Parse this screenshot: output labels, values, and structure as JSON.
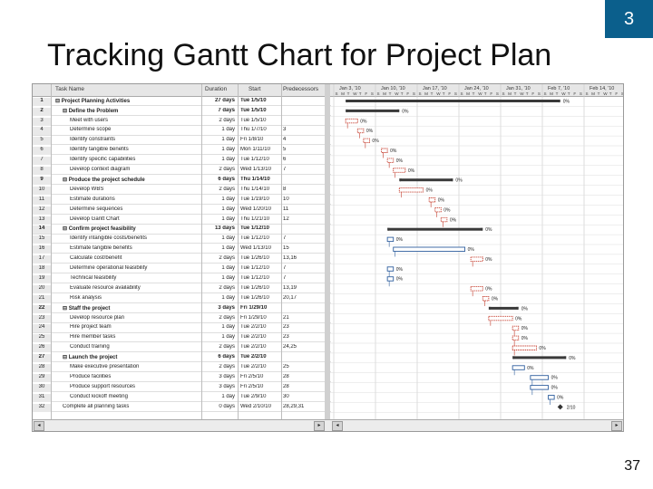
{
  "slide": {
    "title": "Tracking Gantt Chart for Project Plan",
    "section_number": "3",
    "page_number": "37"
  },
  "table": {
    "columns": [
      "Task Name",
      "Duration",
      "Start",
      "Predecessors"
    ],
    "rows": [
      {
        "id": "1",
        "name": "⊟ Project Planning Activities",
        "duration": "27 days",
        "start": "Tue 1/5/10",
        "pred": "",
        "summary": true,
        "indent": 0
      },
      {
        "id": "2",
        "name": "⊟ Define the Problem",
        "duration": "7 days",
        "start": "Tue 1/5/10",
        "pred": "",
        "summary": true,
        "indent": 1
      },
      {
        "id": "3",
        "name": "Meet with users",
        "duration": "2 days",
        "start": "Tue 1/5/10",
        "pred": "",
        "summary": false,
        "indent": 2
      },
      {
        "id": "4",
        "name": "Determine scope",
        "duration": "1 day",
        "start": "Thu 1/7/10",
        "pred": "3",
        "summary": false,
        "indent": 2
      },
      {
        "id": "5",
        "name": "Identify constraints",
        "duration": "1 day",
        "start": "Fri 1/8/10",
        "pred": "4",
        "summary": false,
        "indent": 2
      },
      {
        "id": "6",
        "name": "Identify tangible benefits",
        "duration": "1 day",
        "start": "Mon 1/11/10",
        "pred": "5",
        "summary": false,
        "indent": 2
      },
      {
        "id": "7",
        "name": "Identify specific capabilities",
        "duration": "1 day",
        "start": "Tue 1/12/10",
        "pred": "6",
        "summary": false,
        "indent": 2
      },
      {
        "id": "8",
        "name": "Develop context diagram",
        "duration": "2 days",
        "start": "Wed 1/13/10",
        "pred": "7",
        "summary": false,
        "indent": 2
      },
      {
        "id": "9",
        "name": "⊟ Produce the project schedule",
        "duration": "6 days",
        "start": "Thu 1/14/10",
        "pred": "",
        "summary": true,
        "indent": 1
      },
      {
        "id": "10",
        "name": "Develop WBS",
        "duration": "2 days",
        "start": "Thu 1/14/10",
        "pred": "8",
        "summary": false,
        "indent": 2
      },
      {
        "id": "11",
        "name": "Estimate durations",
        "duration": "1 day",
        "start": "Tue 1/19/10",
        "pred": "10",
        "summary": false,
        "indent": 2
      },
      {
        "id": "12",
        "name": "Determine sequences",
        "duration": "1 day",
        "start": "Wed 1/20/10",
        "pred": "11",
        "summary": false,
        "indent": 2
      },
      {
        "id": "13",
        "name": "Develop Gantt Chart",
        "duration": "1 day",
        "start": "Thu 1/21/10",
        "pred": "12",
        "summary": false,
        "indent": 2
      },
      {
        "id": "14",
        "name": "⊟ Confirm project feasibility",
        "duration": "13 days",
        "start": "Tue 1/12/10",
        "pred": "",
        "summary": true,
        "indent": 1
      },
      {
        "id": "15",
        "name": "Identify intangible costs/benefits",
        "duration": "1 day",
        "start": "Tue 1/12/10",
        "pred": "7",
        "summary": false,
        "indent": 2
      },
      {
        "id": "16",
        "name": "Estimate tangible benefits",
        "duration": "1 day",
        "start": "Wed 1/13/10",
        "pred": "15",
        "summary": false,
        "indent": 2
      },
      {
        "id": "17",
        "name": "Calculate cost/benefit",
        "duration": "2 days",
        "start": "Tue 1/26/10",
        "pred": "13,16",
        "summary": false,
        "indent": 2
      },
      {
        "id": "18",
        "name": "Determine operational feasibility",
        "duration": "1 day",
        "start": "Tue 1/12/10",
        "pred": "7",
        "summary": false,
        "indent": 2
      },
      {
        "id": "19",
        "name": "Technical feasibility",
        "duration": "1 day",
        "start": "Tue 1/12/10",
        "pred": "7",
        "summary": false,
        "indent": 2
      },
      {
        "id": "20",
        "name": "Evaluate resource availability",
        "duration": "2 days",
        "start": "Tue 1/26/10",
        "pred": "13,19",
        "summary": false,
        "indent": 2
      },
      {
        "id": "21",
        "name": "Risk analysis",
        "duration": "1 day",
        "start": "Tue 1/26/10",
        "pred": "20,17",
        "summary": false,
        "indent": 2
      },
      {
        "id": "22",
        "name": "⊟ Staff the project",
        "duration": "3 days",
        "start": "Fri 1/29/10",
        "pred": "",
        "summary": true,
        "indent": 1
      },
      {
        "id": "23",
        "name": "Develop resource plan",
        "duration": "2 days",
        "start": "Fri 1/29/10",
        "pred": "21",
        "summary": false,
        "indent": 2
      },
      {
        "id": "24",
        "name": "Hire project team",
        "duration": "1 day",
        "start": "Tue 2/2/10",
        "pred": "23",
        "summary": false,
        "indent": 2
      },
      {
        "id": "25",
        "name": "Hire member tasks",
        "duration": "1 day",
        "start": "Tue 2/2/10",
        "pred": "23",
        "summary": false,
        "indent": 2
      },
      {
        "id": "26",
        "name": "Conduct training",
        "duration": "2 days",
        "start": "Tue 2/2/10",
        "pred": "24,25",
        "summary": false,
        "indent": 2
      },
      {
        "id": "27",
        "name": "⊟ Launch the project",
        "duration": "6 days",
        "start": "Tue 2/2/10",
        "pred": "",
        "summary": true,
        "indent": 1
      },
      {
        "id": "28",
        "name": "Make executive presentation",
        "duration": "2 days",
        "start": "Tue 2/2/10",
        "pred": "25",
        "summary": false,
        "indent": 2
      },
      {
        "id": "29",
        "name": "Produce facilities",
        "duration": "3 days",
        "start": "Fri 2/5/10",
        "pred": "28",
        "summary": false,
        "indent": 2
      },
      {
        "id": "30",
        "name": "Produce support resources",
        "duration": "3 days",
        "start": "Fri 2/5/10",
        "pred": "28",
        "summary": false,
        "indent": 2
      },
      {
        "id": "31",
        "name": "Conduct kickoff meeting",
        "duration": "1 day",
        "start": "Tue 2/9/10",
        "pred": "30",
        "summary": false,
        "indent": 2
      },
      {
        "id": "32",
        "name": "Complete all planning tasks",
        "duration": "0 days",
        "start": "Wed 2/10/10",
        "pred": "28,29,31",
        "summary": false,
        "indent": 1
      }
    ]
  },
  "timescale": {
    "weeks": [
      "Jan 3, '10",
      "Jan 10, '10",
      "Jan 17, '10",
      "Jan 24, '10",
      "Jan 31, '10",
      "Feb 7, '10",
      "Feb 14, '10"
    ],
    "days": [
      "S",
      "M",
      "T",
      "W",
      "T",
      "F",
      "S"
    ]
  },
  "gantt_labels": {
    "r1": "0%",
    "r2": "0%",
    "r3": "0%",
    "r4": "0%",
    "r5": "0%",
    "r6": "0%",
    "r7": "0%",
    "r8": "0%",
    "r9": "0%",
    "r10": "0%",
    "r11": "0%",
    "r12": "0%",
    "r13": "0%",
    "r14": "0%",
    "r15": "0%",
    "r16": "0%",
    "r17": "0%",
    "r18": "0%",
    "r19": "0%",
    "r20": "0%",
    "r21": "0%",
    "r22": "0%",
    "r23": "0%",
    "r24": "0%",
    "r25": "0%",
    "r26": "0%",
    "r27": "0%",
    "r28": "0%",
    "r29": "0%",
    "r30": "0%",
    "r31": "0%",
    "r32": "2/10"
  },
  "colors": {
    "accent": "#0b5f8c",
    "summary_bar": "#3a3a3a",
    "critical": "#c43a2a",
    "normal": "#2f5f9e",
    "grid": "#dcdcdc"
  }
}
